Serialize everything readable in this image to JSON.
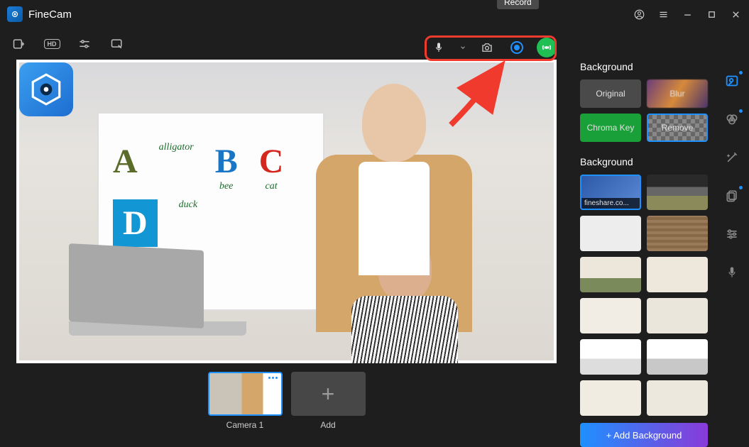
{
  "app": {
    "title": "FineCam"
  },
  "tooltip": {
    "record": "Record"
  },
  "toolbar": {
    "hd": "HD"
  },
  "backgroundSection": {
    "heading1": "Background",
    "modes": {
      "original": "Original",
      "blur": "Blur",
      "chroma": "Chroma Key",
      "remove": "Remove"
    },
    "heading2": "Background",
    "thumbs": [
      {
        "label": "fineshare.co..."
      },
      {},
      {},
      {},
      {},
      {},
      {},
      {},
      {},
      {},
      {},
      {}
    ],
    "addBtn": "+ Add Background"
  },
  "scenes": {
    "items": [
      {
        "label": "Camera 1"
      }
    ],
    "addLabel": "Add"
  },
  "whiteboard": {
    "a": {
      "word": "alligator"
    },
    "b": {
      "word": "bee"
    },
    "c": {
      "word": "cat"
    },
    "d": {
      "word": "duck"
    }
  }
}
